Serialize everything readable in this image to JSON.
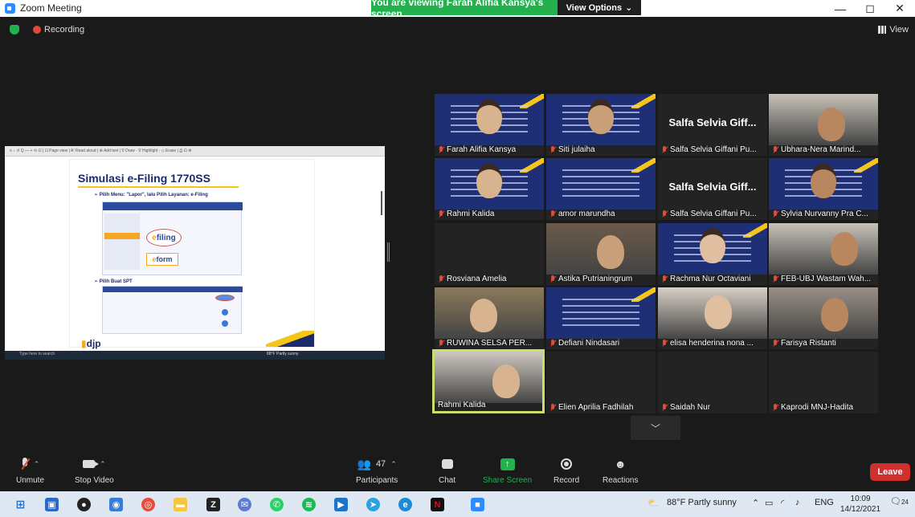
{
  "window": {
    "title": "Zoom Meeting",
    "share_banner": "You are viewing Farah Alifia Kansya's screen",
    "view_options": "View Options",
    "minimize": "—",
    "maximize": "◻",
    "close": "✕"
  },
  "topbar": {
    "recording": "Recording",
    "view": "View"
  },
  "shared_slide": {
    "toolbar_text": "≡  ↓  ↺  Q          —  +   ⟲  ⊡  |  ⊡ Page view  |  A⁾ Read aloud  |  ⊕ Add text  |  ∇ Draw  ·  ∇ Highlight  ·  ◇ Erase  |  ⎙  ⊡  ⚙",
    "title": "Simulasi e-Filing 1770SS",
    "bullet1": "Pilih Menu: \"Lapor\", lalu Pilih Layanan: e-Filing",
    "bullet2": "Pilih Buat SPT",
    "efiling": "filing",
    "eform": "form",
    "logo": "djp",
    "search_placeholder": "Type here to search",
    "weather": "88°F Partly sunny"
  },
  "participants": [
    {
      "name": "Farah Alifia Kansya",
      "type": "poster",
      "face": true
    },
    {
      "name": "Siti julaiha",
      "type": "poster",
      "face": true
    },
    {
      "name": "Salfa Selvia Giffani Pu...",
      "type": "text",
      "display": "Salfa Selvia Giff..."
    },
    {
      "name": "Ubhara-Nera Marind...",
      "type": "photo"
    },
    {
      "name": "Rahmi Kalida",
      "type": "poster",
      "face": true
    },
    {
      "name": "amor marundha",
      "type": "poster",
      "face": false
    },
    {
      "name": "Salfa Selvia Giffani Pu...",
      "type": "text",
      "display": "Salfa Selvia Giff..."
    },
    {
      "name": "Sylvia Nurvanny Pra C...",
      "type": "poster",
      "face": true
    },
    {
      "name": "Rosviana Amelia",
      "type": "blank"
    },
    {
      "name": "Astika Putrianingrum",
      "type": "photo"
    },
    {
      "name": "Rachma Nur Octaviani",
      "type": "poster",
      "face": true
    },
    {
      "name": "FEB-UBJ Wastam Wah...",
      "type": "photo"
    },
    {
      "name": "RUWINA SELSA PER...",
      "type": "photo"
    },
    {
      "name": "Defiani Nindasari",
      "type": "poster",
      "face": false
    },
    {
      "name": "elisa henderina nona ...",
      "type": "photo"
    },
    {
      "name": "Farisya Ristanti",
      "type": "photo"
    },
    {
      "name": "Rahmi Kalida",
      "type": "photo",
      "active": true
    },
    {
      "name": "Elien Aprilia Fadhilah",
      "type": "blank"
    },
    {
      "name": "Saidah Nur",
      "type": "blank"
    },
    {
      "name": "Kaprodi MNJ-Hadita",
      "type": "blank"
    }
  ],
  "controls": {
    "unmute": "Unmute",
    "stop_video": "Stop Video",
    "participants": "Participants",
    "participant_count": "47",
    "chat": "Chat",
    "share_screen": "Share Screen",
    "record": "Record",
    "reactions": "Reactions",
    "leave": "Leave"
  },
  "taskbar": {
    "weather": "88°F  Partly sunny",
    "lang": "ENG",
    "time": "10:09",
    "date": "14/12/2021",
    "notifications": "24"
  },
  "colors": {
    "share_banner": "#22b14c",
    "leave": "#d0302d",
    "active_speaker": "#c8e06b",
    "poster": "#1e2f75"
  }
}
